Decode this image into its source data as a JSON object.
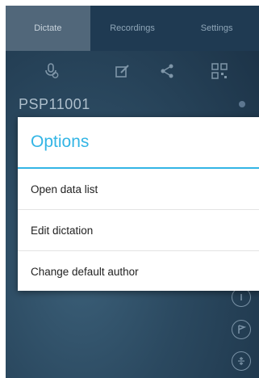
{
  "tabs": [
    {
      "label": "Dictate",
      "active": true
    },
    {
      "label": "Recordings",
      "active": false
    },
    {
      "label": "Settings",
      "active": false
    }
  ],
  "toolbar_icons": [
    "microphone-settings-icon",
    "edit-icon",
    "share-icon",
    "qr-code-icon"
  ],
  "dictation": {
    "id": "PSP11001"
  },
  "dialog": {
    "title": "Options",
    "options": [
      "Open data list",
      "Edit dictation",
      "Change default author"
    ]
  },
  "colors": {
    "accent": "#33b5e5",
    "tab_active": "#51677a",
    "background": "#2b4960"
  }
}
